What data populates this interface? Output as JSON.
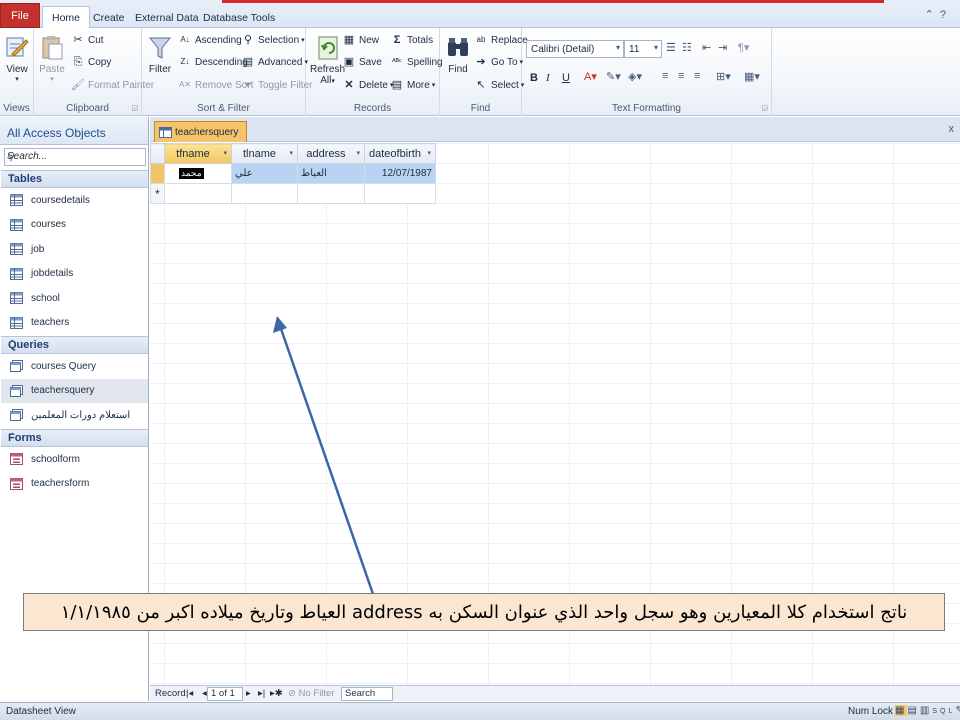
{
  "ribbon_tabs": {
    "file": "File",
    "home": "Home",
    "create": "Create",
    "external_data": "External Data",
    "database_tools": "Database Tools"
  },
  "views_group": {
    "view": "View",
    "label": "Views"
  },
  "clipboard": {
    "paste": "Paste",
    "cut": "Cut",
    "copy": "Copy",
    "format_painter": "Format Painter",
    "label": "Clipboard"
  },
  "sort_filter": {
    "filter": "Filter",
    "ascending": "Ascending",
    "descending": "Descending",
    "remove_sort": "Remove Sort",
    "selection": "Selection",
    "advanced": "Advanced",
    "toggle_filter": "Toggle Filter",
    "label": "Sort & Filter"
  },
  "records": {
    "refresh": "Refresh",
    "refresh_all": "All",
    "new": "New",
    "save": "Save",
    "delete": "Delete",
    "totals": "Totals",
    "spelling": "Spelling",
    "more": "More",
    "label": "Records"
  },
  "find_group": {
    "find": "Find",
    "replace": "Replace",
    "goto": "Go To",
    "select": "Select",
    "label": "Find"
  },
  "text_formatting": {
    "font": "Calibri (Detail)",
    "size": "11",
    "bold": "B",
    "italic": "I",
    "underline": "U",
    "label": "Text Formatting"
  },
  "nav": {
    "title": "All Access Objects",
    "search_placeholder": "Search...",
    "tables_header": "Tables",
    "tables": [
      "coursedetails",
      "courses",
      "job",
      "jobdetails",
      "school",
      "teachers"
    ],
    "queries_header": "Queries",
    "queries": [
      "courses Query",
      "teachersquery",
      "استعلام دورات المعلمين"
    ],
    "forms_header": "Forms",
    "forms": [
      "schoolform",
      "teachersform"
    ]
  },
  "document": {
    "tab_title": "teachersquery",
    "close": "x",
    "columns": [
      "tfname",
      "tlname",
      "address",
      "dateofbirth"
    ],
    "rows": [
      {
        "tfname": "محمد",
        "tlname": "علي",
        "address": "العياط",
        "dateofbirth": "12/07/1987"
      }
    ],
    "new_row_marker": "*"
  },
  "record_nav": {
    "label": "Record:",
    "position": "1 of 1",
    "no_filter": "No Filter",
    "search": "Search"
  },
  "status": {
    "view": "Datasheet View",
    "numlock": "Num Lock"
  },
  "annotation": {
    "caption": "ناتج استخدام كلا المعيارين وهو سجل واحد الذي عنوان السكن به address العياط وتاريخ ميلاده اكبر من ١/١/١٩٨٥"
  },
  "colors": {
    "file_tab": "#c4302b",
    "accent_red": "#d8262b",
    "active_tab": "#f4c36a",
    "caption_bg": "#fbe6d1",
    "arrow": "#3d65a8"
  }
}
